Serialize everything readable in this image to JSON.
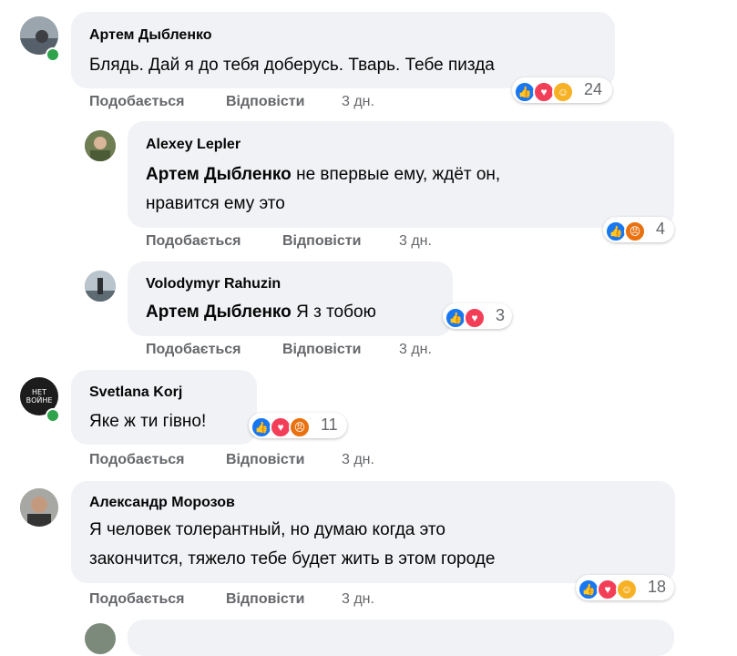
{
  "comments": [
    {
      "author": "Артем Дыбленко",
      "text": "Блядь. Дай я до тебя доберусь. Тварь. Тебе пизда",
      "reactions_count": "24",
      "like": "Подобається",
      "reply": "Відповісти",
      "time": "3 дн."
    },
    {
      "author": "Alexey Lepler",
      "mention": "Артем Дыбленко",
      "text_line1": " не впервые ему, ждёт он,",
      "text_line2": "нравится ему это",
      "reactions_count": "4",
      "like": "Подобається",
      "reply": "Відповісти",
      "time": "3 дн."
    },
    {
      "author": "Volodymyr Rahuzin",
      "mention": "Артем Дыбленко",
      "text": " Я з тобою",
      "reactions_count": "3",
      "like": "Подобається",
      "reply": "Відповісти",
      "time": "3 дн."
    },
    {
      "author": "Svetlana Korj",
      "avatar_text": "НЕТ ВОЙНЕ",
      "text": "Яке ж ти гівно!",
      "reactions_count": "11",
      "like": "Подобається",
      "reply": "Відповісти",
      "time": "3 дн."
    },
    {
      "author": "Александр Морозов",
      "text_line1": "Я человек толерантный, но думаю когда это",
      "text_line2": "закончится, тяжело тебе будет жить в этом городе",
      "reactions_count": "18",
      "like": "Подобається",
      "reply": "Відповісти",
      "time": "3 дн."
    }
  ],
  "colors": {
    "bubble": "#f0f2f5",
    "meta_text": "#65676b",
    "like": "#1877f2",
    "love": "#f33e58",
    "angry": "#e9710f",
    "care": "#f7b125",
    "online": "#31a24c"
  }
}
